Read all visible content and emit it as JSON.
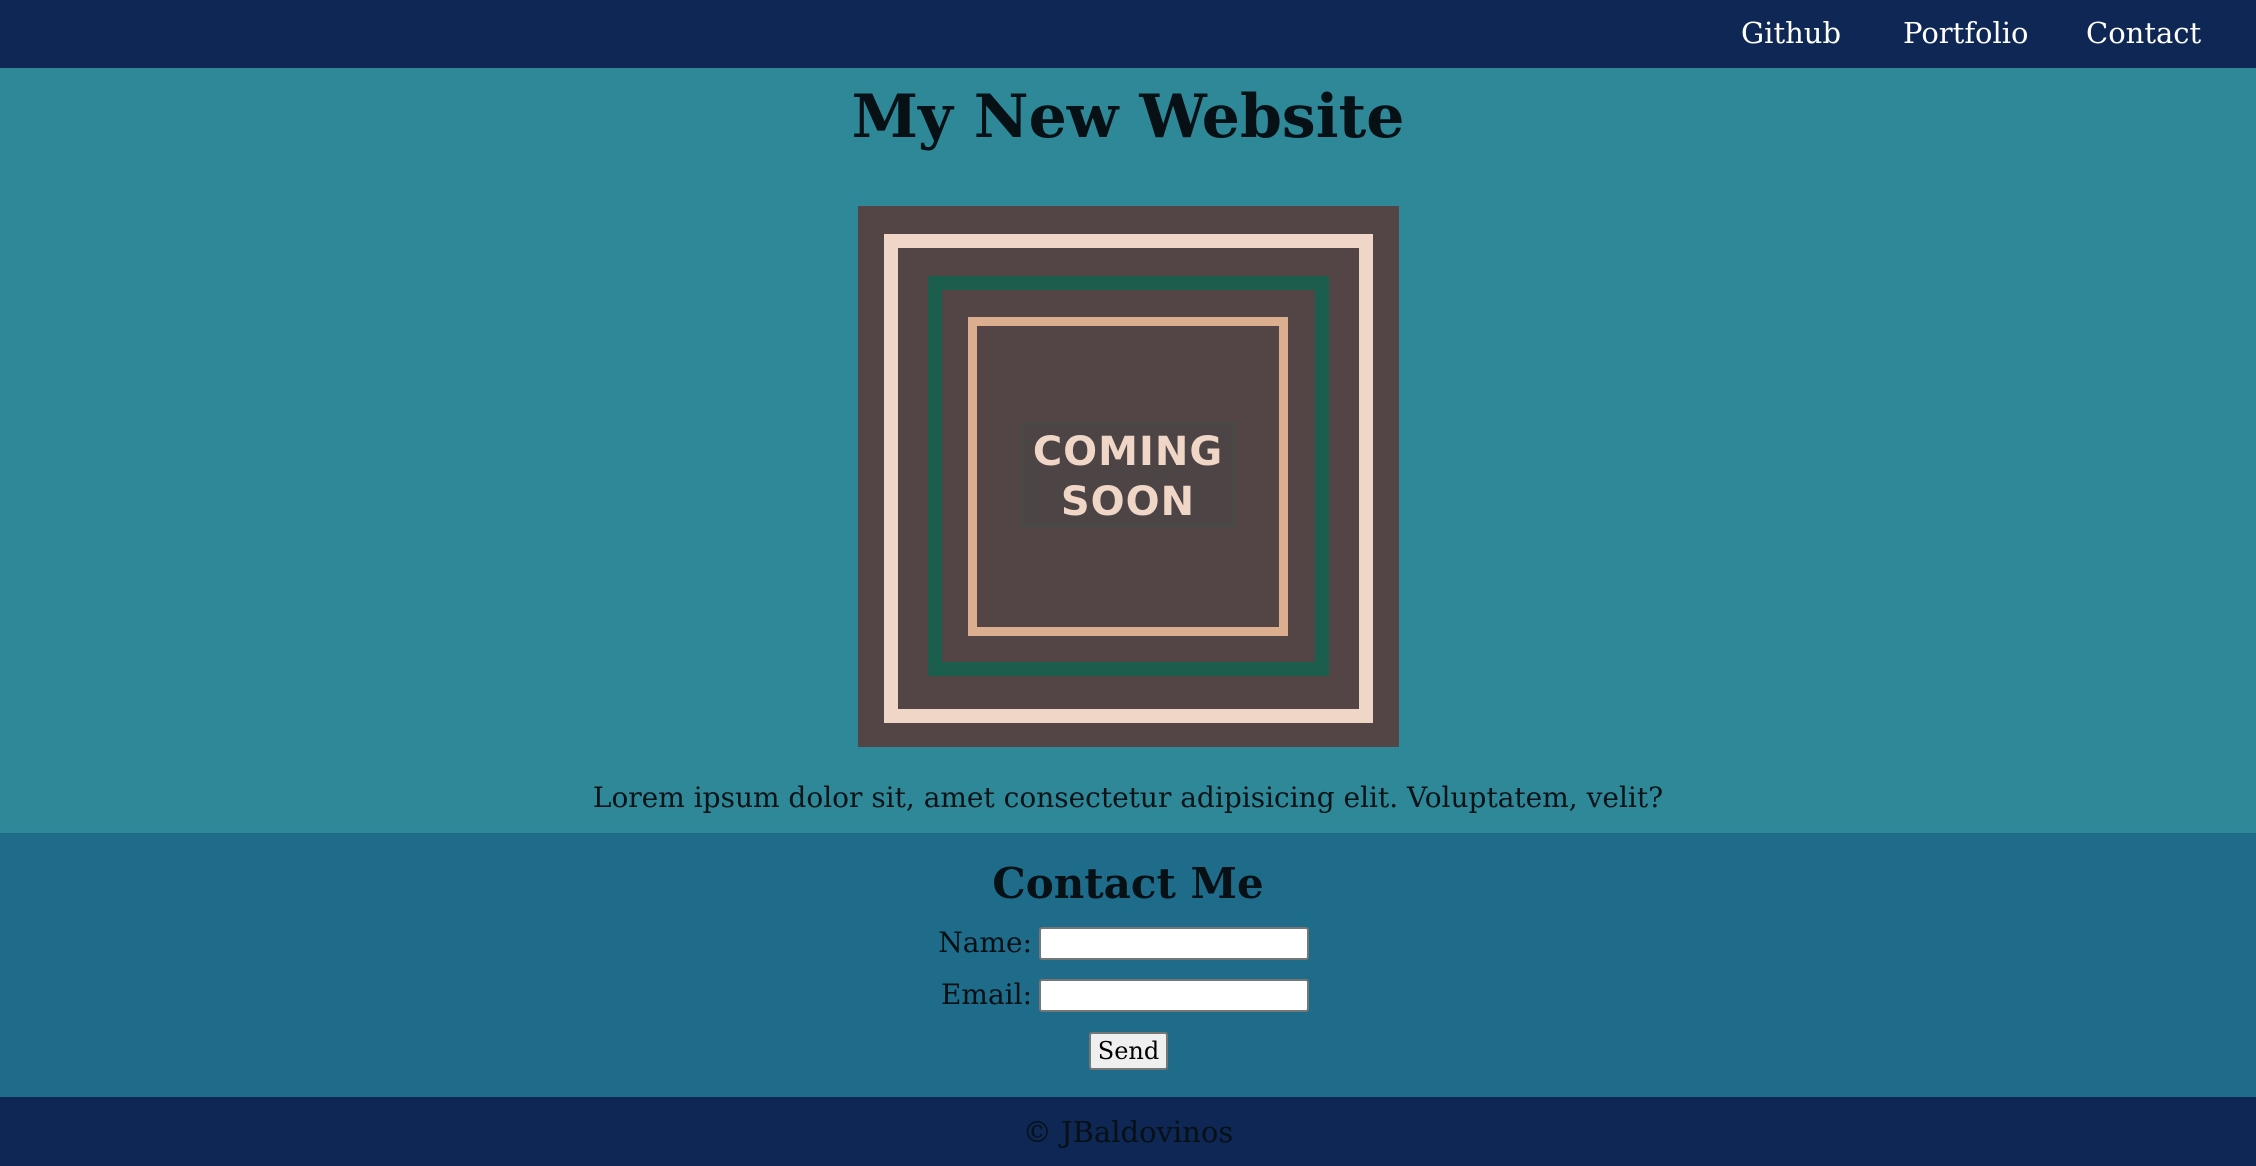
{
  "nav": {
    "links": [
      "Github",
      "Portfolio",
      "Contact"
    ]
  },
  "hero": {
    "title": "My New Website",
    "image_text_line1": "COMING",
    "image_text_line2": "SOON",
    "description": "Lorem ipsum dolor sit, amet consectetur adipisicing elit. Voluptatem, velit?"
  },
  "contact": {
    "title": "Contact Me",
    "name_label": "Name:",
    "name_value": "",
    "email_label": "Email:",
    "email_value": "",
    "send_label": "Send"
  },
  "footer": {
    "copyright": "© JBaldovinos"
  },
  "colors": {
    "nav_background": "#0e2754",
    "hero_background": "#2e8898",
    "contact_background": "#1e6c8a",
    "image_background": "#534445"
  }
}
